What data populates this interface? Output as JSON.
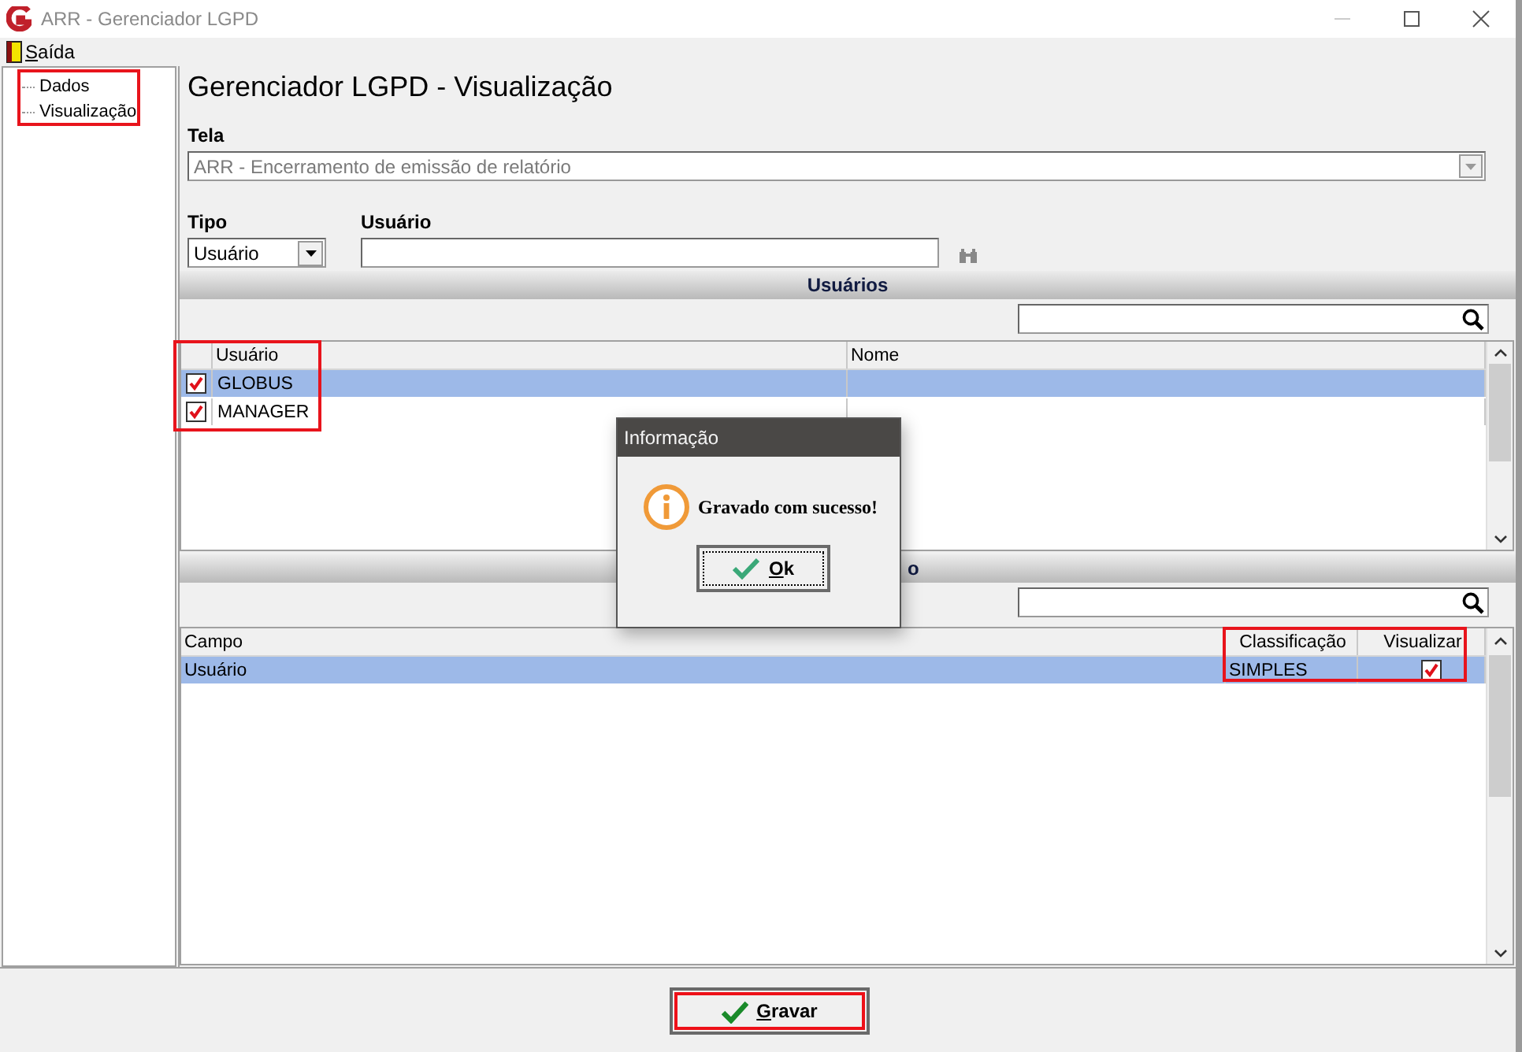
{
  "window": {
    "title": "ARR - Gerenciador LGPD"
  },
  "menu": [
    {
      "label": "Saída"
    }
  ],
  "sidebar": {
    "highlighted": true,
    "items": [
      {
        "label": "Dados"
      },
      {
        "label": "Visualização"
      }
    ]
  },
  "heading": "Gerenciador LGPD - Visualização",
  "screen_field": {
    "label": "Tela",
    "value": "ARR - Encerramento de emissão de relatório",
    "disabled": true
  },
  "type_field": {
    "label": "Tipo",
    "value": "Usuário"
  },
  "user_field": {
    "label": "Usuário"
  },
  "sections": [
    {
      "kind": "users",
      "title": "Usuários",
      "highlighted": true,
      "columns": [
        "Usuário",
        "Nome"
      ],
      "rows": [
        {
          "user": "GLOBUS",
          "checked": true,
          "selected": true
        },
        {
          "user": "MANAGER",
          "checked": true,
          "selected": false
        }
      ]
    },
    {
      "kind": "fields",
      "title": "o",
      "highlighted": true,
      "columns": [
        "Campo",
        "Classificação",
        "Visualizar"
      ],
      "rows": [
        {
          "field": "Usuário",
          "classification": "SIMPLES",
          "visualize": true,
          "selected": true
        }
      ]
    }
  ],
  "save_button": {
    "label": "Gravar",
    "highlighted": true
  },
  "dialog": {
    "title": "Informação",
    "message": "Gravado com sucesso!",
    "button": "Ok"
  }
}
